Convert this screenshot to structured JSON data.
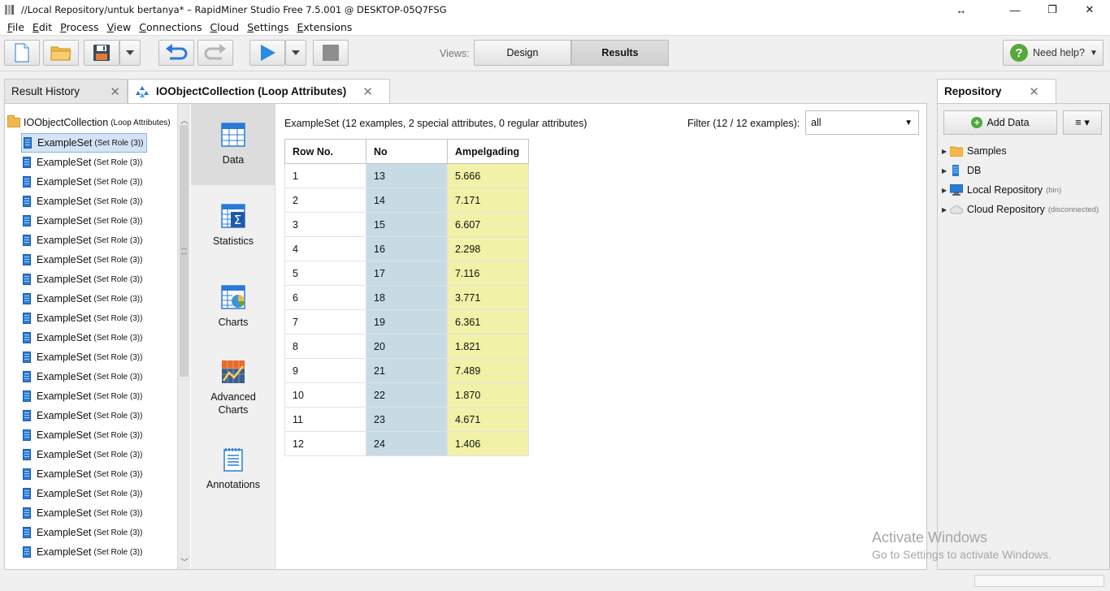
{
  "window": {
    "title": "//Local Repository/untuk bertanya* – RapidMiner Studio Free 7.5.001 @ DESKTOP-05Q7FSG",
    "controls": [
      "↔",
      "—",
      "❐",
      "✕"
    ]
  },
  "menu": [
    "File",
    "Edit",
    "Process",
    "View",
    "Connections",
    "Cloud",
    "Settings",
    "Extensions"
  ],
  "toolbar": {
    "views_label": "Views:",
    "design_label": "Design",
    "results_label": "Results",
    "help_label": "Need help?"
  },
  "tabs": {
    "history": "Result History",
    "collection": "IOObjectCollection (Loop Attributes)",
    "repository": "Repository"
  },
  "tree": {
    "root_label": "IOObjectCollection",
    "root_sub": "(Loop Attributes)",
    "item_label": "ExampleSet",
    "item_sub": "(Set Role (3))",
    "items": [
      "ExampleSet",
      "ExampleSet",
      "ExampleSet",
      "ExampleSet",
      "ExampleSet",
      "ExampleSet",
      "ExampleSet",
      "ExampleSet",
      "ExampleSet",
      "ExampleSet",
      "ExampleSet",
      "ExampleSet",
      "ExampleSet",
      "ExampleSet",
      "ExampleSet",
      "ExampleSet",
      "ExampleSet",
      "ExampleSet",
      "ExampleSet",
      "ExampleSet",
      "ExampleSet",
      "ExampleSet"
    ]
  },
  "nav": {
    "data": "Data",
    "statistics": "Statistics",
    "charts": "Charts",
    "advanced_1": "Advanced",
    "advanced_2": "Charts",
    "annotations": "Annotations"
  },
  "content": {
    "info": "ExampleSet (12 examples, 2 special attributes, 0 regular attributes)",
    "filter_label": "Filter (12 / 12 examples):",
    "filter_value": "all",
    "columns": [
      "Row No.",
      "No",
      "Ampelgading"
    ],
    "rows": [
      [
        "1",
        "13",
        "5.666"
      ],
      [
        "2",
        "14",
        "7.171"
      ],
      [
        "3",
        "15",
        "6.607"
      ],
      [
        "4",
        "16",
        "2.298"
      ],
      [
        "5",
        "17",
        "7.116"
      ],
      [
        "6",
        "18",
        "3.771"
      ],
      [
        "7",
        "19",
        "6.361"
      ],
      [
        "8",
        "20",
        "1.821"
      ],
      [
        "9",
        "21",
        "7.489"
      ],
      [
        "10",
        "22",
        "1.870"
      ],
      [
        "11",
        "23",
        "4.671"
      ],
      [
        "12",
        "24",
        "1.406"
      ]
    ]
  },
  "repository": {
    "add_data": "Add Data",
    "menu_icon": "≡ ▾",
    "items": [
      {
        "label": "Samples",
        "note": ""
      },
      {
        "label": "DB",
        "note": ""
      },
      {
        "label": "Local Repository",
        "note": "(bin)"
      },
      {
        "label": "Cloud Repository",
        "note": "(disconnected)"
      }
    ]
  },
  "watermark": {
    "line1": "Activate Windows",
    "line2": "Go to Settings to activate Windows."
  },
  "colors": {
    "no_column": "#c7dbe5",
    "ampelgading_column": "#f1f1a7",
    "selection": "#d4e4f7"
  }
}
